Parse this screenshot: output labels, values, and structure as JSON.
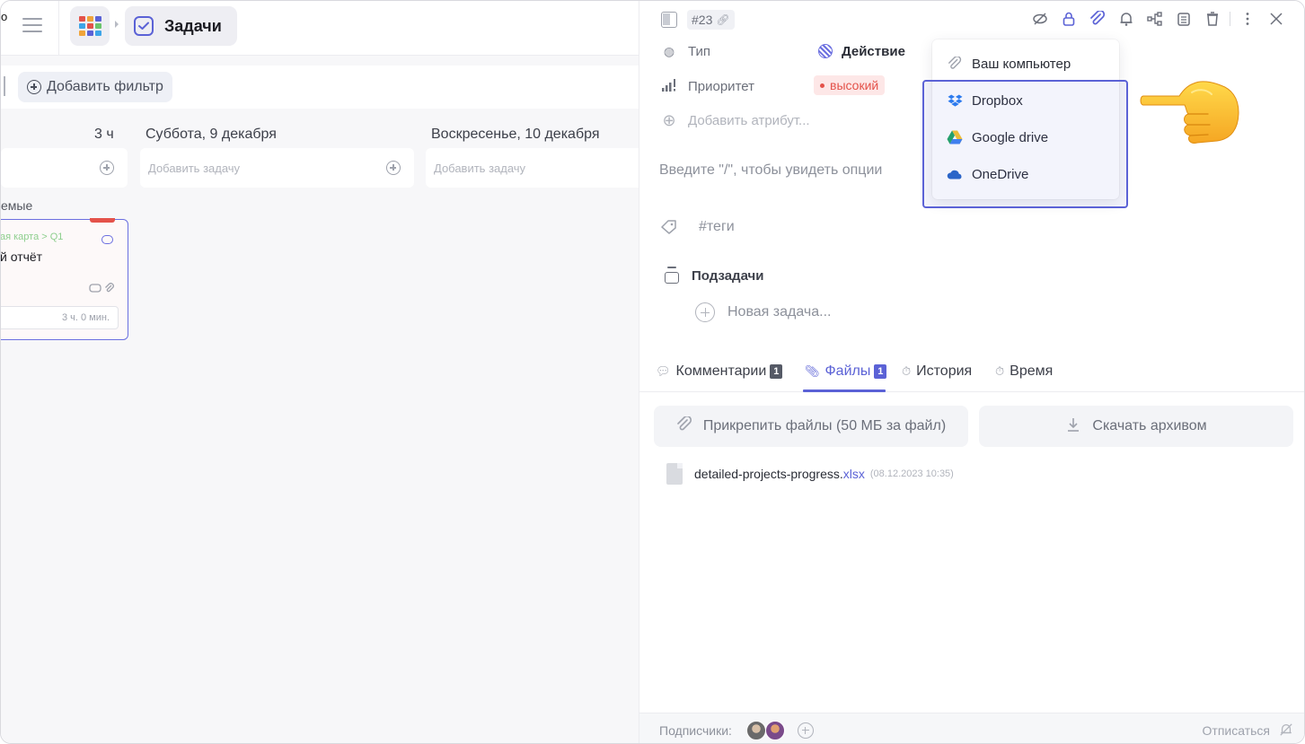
{
  "left": {
    "cut_text": "о",
    "app_title": "Задачи",
    "add_filter": "Добавить фильтр",
    "columns": [
      {
        "header": "3 ч",
        "add_placeholder": ""
      },
      {
        "header": "Суббота, 9 декабря",
        "add_placeholder": "Добавить задачу"
      },
      {
        "header": "Воскресенье, 10 декабря",
        "add_placeholder": "Добавить задачу"
      }
    ],
    "section_label": "емые",
    "card": {
      "path": "ая карта > Q1",
      "name": "й отчёт",
      "time": "3 ч. 0 мин."
    }
  },
  "task": {
    "id": "#23",
    "attributes": {
      "type_label": "Тип",
      "type_value": "Действие",
      "priority_label": "Приоритет",
      "priority_value": "высокий",
      "add_attribute": "Добавить атрибут..."
    },
    "editor_placeholder": "Введите \"/\", чтобы увидеть опции",
    "tags_placeholder": "#теги",
    "subtasks_title": "Подзадачи",
    "new_subtask": "Новая задача...",
    "tabs": [
      {
        "label": "Комментарии",
        "count": "1"
      },
      {
        "label": "Файлы",
        "count": "1"
      },
      {
        "label": "История",
        "count": ""
      },
      {
        "label": "Время",
        "count": ""
      }
    ],
    "attach_button": "Прикрепить файлы (50 МБ за файл)",
    "archive_button": "Скачать архивом",
    "file": {
      "name": "detailed-projects-progress.",
      "ext": "xlsx",
      "date": "(08.12.2023 10:35)"
    },
    "footer": {
      "subscribers_label": "Подписчики:",
      "unsubscribe": "Отписаться"
    }
  },
  "attach_menu": {
    "items": [
      {
        "label": "Ваш компьютер",
        "icon": "paperclip-icon"
      },
      {
        "label": "Dropbox",
        "icon": "dropbox-icon"
      },
      {
        "label": "Google drive",
        "icon": "google-drive-icon"
      },
      {
        "label": "OneDrive",
        "icon": "onedrive-icon"
      }
    ]
  },
  "colors": {
    "accent": "#5b62d6",
    "priority_high": "#e4524a",
    "dropbox": "#2b7df0",
    "onedrive": "#2866c8"
  }
}
